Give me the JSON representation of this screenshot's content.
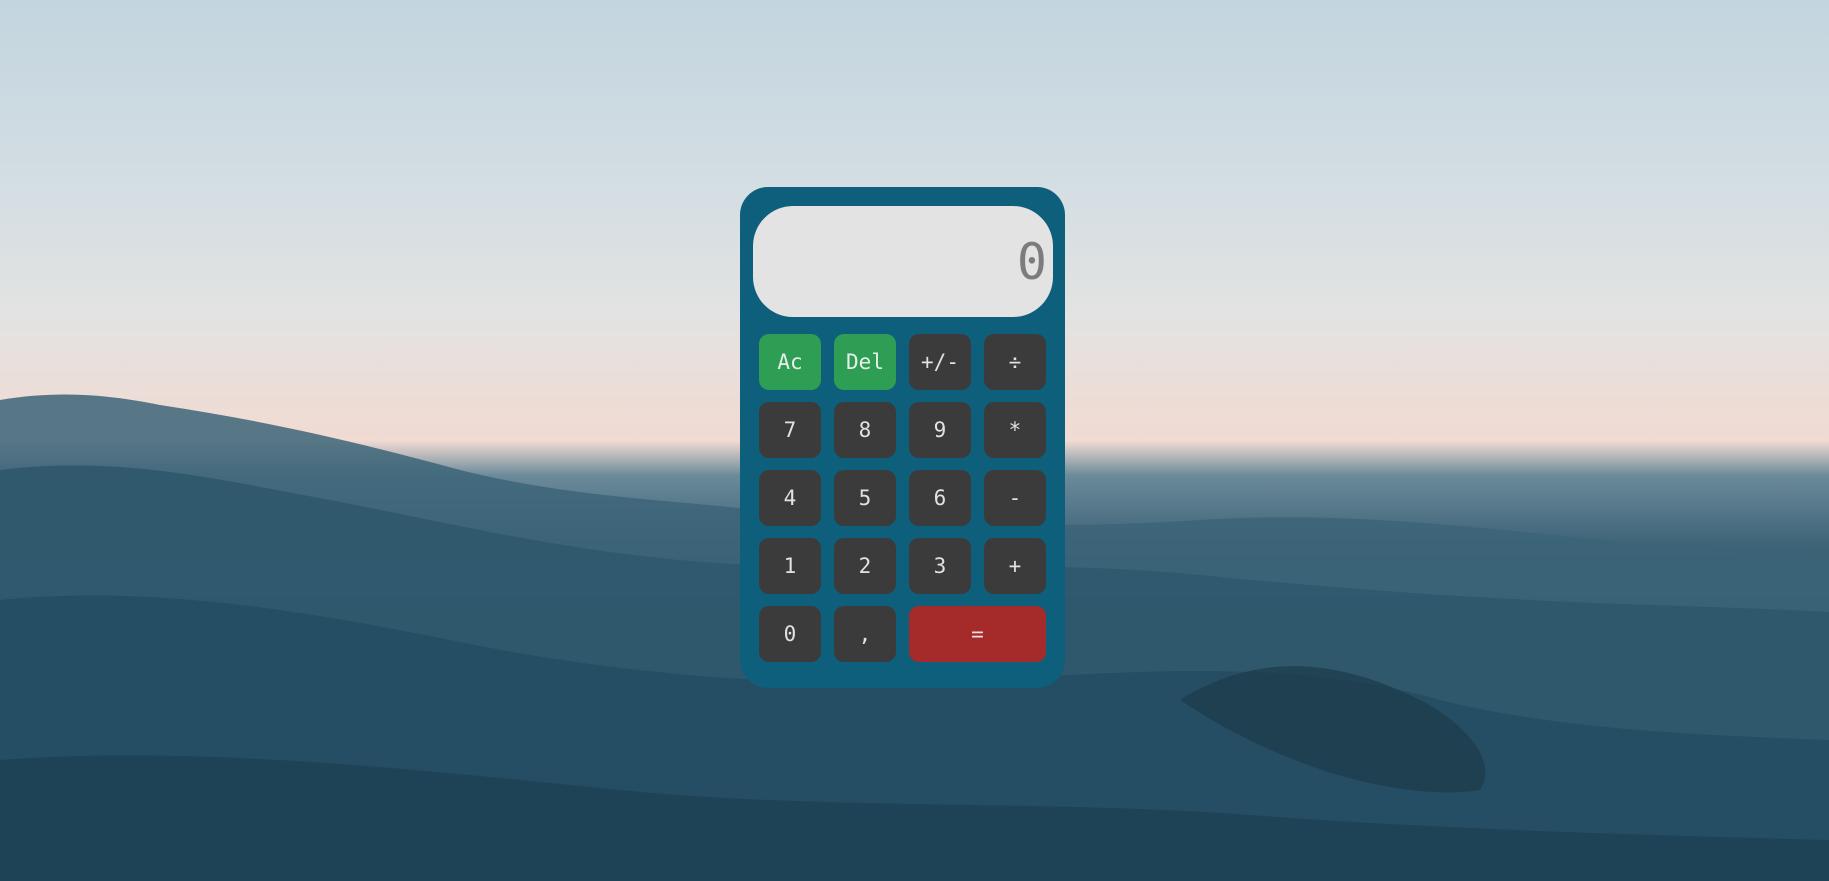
{
  "background": {
    "description_icon": "ocean-waves-icon"
  },
  "calculator": {
    "display": "0",
    "keys": [
      {
        "label": "Ac",
        "kind": "clear"
      },
      {
        "label": "Del",
        "kind": "clear"
      },
      {
        "label": "+/-",
        "kind": "op"
      },
      {
        "label": "÷",
        "kind": "op"
      },
      {
        "label": "7",
        "kind": "num"
      },
      {
        "label": "8",
        "kind": "num"
      },
      {
        "label": "9",
        "kind": "num"
      },
      {
        "label": "*",
        "kind": "op"
      },
      {
        "label": "4",
        "kind": "num"
      },
      {
        "label": "5",
        "kind": "num"
      },
      {
        "label": "6",
        "kind": "num"
      },
      {
        "label": "-",
        "kind": "op"
      },
      {
        "label": "1",
        "kind": "num"
      },
      {
        "label": "2",
        "kind": "num"
      },
      {
        "label": "3",
        "kind": "num"
      },
      {
        "label": "+",
        "kind": "op"
      },
      {
        "label": "0",
        "kind": "num"
      },
      {
        "label": ",",
        "kind": "num"
      },
      {
        "label": "=",
        "kind": "equals"
      }
    ]
  },
  "colors": {
    "body": "#0e5f7b",
    "display_bg": "#e3e3e3",
    "key": "#3b3b3b",
    "clear_key": "#2f9e55",
    "equals_key": "#a52a2a"
  }
}
